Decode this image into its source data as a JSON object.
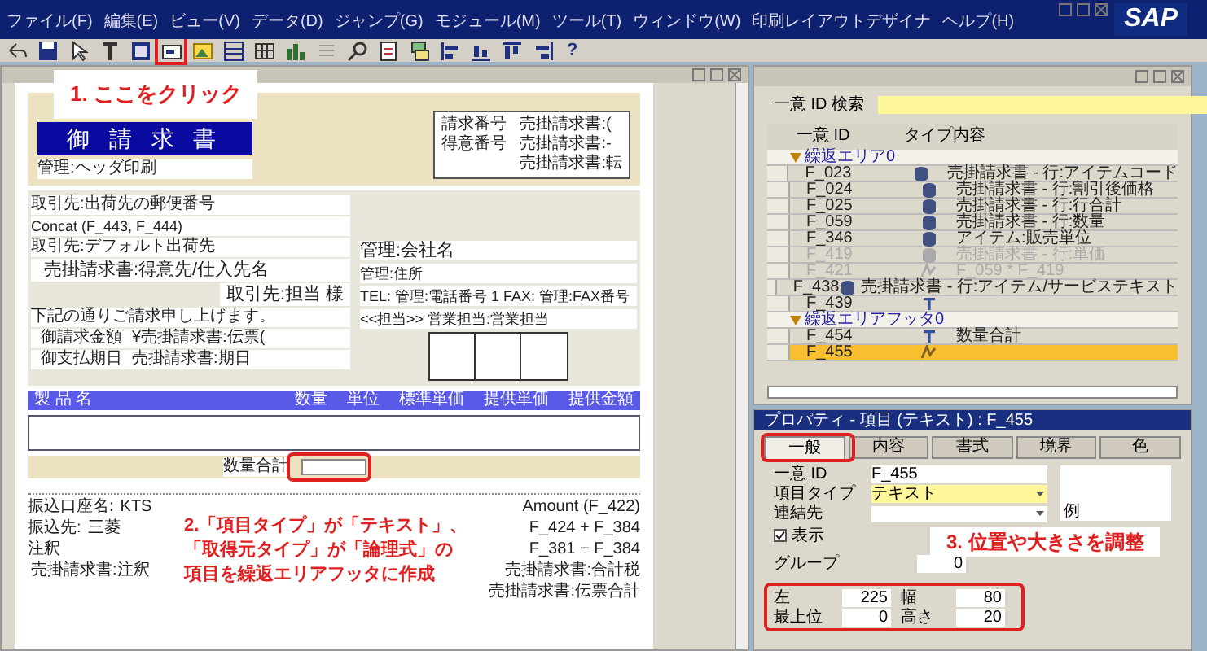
{
  "menu": [
    "ファイル(F)",
    "編集(E)",
    "ビュー(V)",
    "データ(D)",
    "ジャンプ(G)",
    "モジュール(M)",
    "ツール(T)",
    "ウィンドウ(W)",
    "印刷レイアウトデザイナ",
    "ヘルプ(H)"
  ],
  "brand": "SAP",
  "toolbar": [
    {
      "kind": "undo",
      "highlighted": false
    },
    {
      "kind": "save",
      "highlighted": false
    },
    {
      "kind": "pointer",
      "highlighted": false
    },
    {
      "kind": "text",
      "highlighted": false
    },
    {
      "kind": "frame",
      "highlighted": false
    },
    {
      "kind": "field",
      "highlighted": true
    },
    {
      "kind": "picture",
      "highlighted": false
    },
    {
      "kind": "table",
      "highlighted": false
    },
    {
      "kind": "grid",
      "highlighted": false
    },
    {
      "kind": "bars",
      "highlighted": false
    },
    {
      "kind": "lines",
      "highlighted": false
    },
    {
      "kind": "zoom",
      "highlighted": false
    },
    {
      "kind": "page",
      "highlighted": false
    },
    {
      "kind": "layers",
      "highlighted": false
    },
    {
      "kind": "align-left",
      "highlighted": false
    },
    {
      "kind": "align-bottom",
      "highlighted": false
    },
    {
      "kind": "align-top",
      "highlighted": false
    },
    {
      "kind": "align-right",
      "highlighted": false
    }
  ],
  "help_button": "?",
  "form": {
    "title": "御 請 求 書",
    "header_note": "管理:ヘッダ印刷",
    "info_box": [
      {
        "label": "請求番号",
        "value": "売掛請求書:("
      },
      {
        "label": "得意番号",
        "value": "売掛請求書:-"
      },
      {
        "value": "売掛請求書:転"
      }
    ],
    "address_left": [
      "取引先:出荷先の郵便番号",
      "Concat (F_443, F_444)",
      "取引先:デフォルト出荷先",
      "売掛請求書:得意先/仕入先名",
      "取引先:担当 様",
      "下記の通りご請求申し上げます。"
    ],
    "amount": {
      "label": "御請求金額",
      "value": "¥売掛請求書:伝票("
    },
    "due": {
      "label": "御支払期日",
      "value": "売掛請求書:期日"
    },
    "company": [
      "管理:会社名",
      "管理:住所",
      "TEL: 管理:電話番号 1 FAX: 管理:FAX番号",
      "<<担当>> 営業担当:営業担当"
    ],
    "columns": [
      "製 品 名",
      "数量",
      "単位",
      "標準単価",
      "提供単価",
      "提供金額"
    ],
    "footer_label": "数量合計",
    "bank": [
      {
        "label": "振込口座名:",
        "value": "KTS"
      },
      {
        "label": "振込先:",
        "value": "三菱"
      }
    ],
    "note_label": "注釈",
    "note_value": "売掛請求書:注釈",
    "totals": [
      "Amount (F_422)",
      "F_424 + F_384",
      "F_381 − F_384",
      "売掛請求書:合計税",
      "売掛請求書:伝票合計"
    ]
  },
  "callouts": [
    {
      "lines": [
        "1. ここをクリック"
      ]
    },
    {
      "lines": [
        "2.「項目タイプ」が「テキスト」、",
        "「取得元タイプ」が「論理式」の",
        "項目を繰返エリアフッタに作成"
      ]
    },
    {
      "lines": [
        "3. 位置や大きさを調整"
      ]
    }
  ],
  "item_list": {
    "search_label": "一意 ID 検索",
    "columns": [
      "一意 ID",
      "タイプ",
      "内容"
    ],
    "groups": [
      {
        "name": "繰返エリア0",
        "expanded": true,
        "rows": [
          {
            "id": "F_023",
            "kind": "field",
            "content": "売掛請求書 - 行:アイテムコード",
            "disabled": false,
            "selected": false
          },
          {
            "id": "F_024",
            "kind": "field",
            "content": "売掛請求書 - 行:割引後価格",
            "disabled": false,
            "selected": false
          },
          {
            "id": "F_025",
            "kind": "field",
            "content": "売掛請求書 - 行:行合計",
            "disabled": false,
            "selected": false
          },
          {
            "id": "F_059",
            "kind": "field",
            "content": "売掛請求書 - 行:数量",
            "disabled": false,
            "selected": false
          },
          {
            "id": "F_346",
            "kind": "field",
            "content": "アイテム:販売単位",
            "disabled": false,
            "selected": false
          },
          {
            "id": "F_419",
            "kind": "field",
            "content": "売掛請求書 - 行:単価",
            "disabled": true,
            "selected": false
          },
          {
            "id": "F_421",
            "kind": "formula",
            "content": "F_059 * F_419",
            "disabled": true,
            "selected": false
          },
          {
            "id": "F_438",
            "kind": "field",
            "content": "売掛請求書 - 行:アイテム/サービステキスト",
            "disabled": false,
            "selected": false
          },
          {
            "id": "F_439",
            "kind": "text",
            "disabled": false,
            "selected": false
          }
        ]
      },
      {
        "name": "繰返エリアフッタ0",
        "expanded": true,
        "rows": [
          {
            "id": "F_454",
            "kind": "text",
            "content": "数量合計",
            "disabled": false,
            "selected": false
          },
          {
            "id": "F_455",
            "kind": "formula",
            "disabled": false,
            "selected": true
          }
        ]
      }
    ]
  },
  "properties": {
    "title": "プロパティ - 項目 (テキスト) : F_455",
    "tabs": [
      {
        "label": "一般",
        "selected": true
      },
      {
        "label": "内容",
        "selected": false
      },
      {
        "label": "書式",
        "selected": false
      },
      {
        "label": "境界",
        "selected": false
      },
      {
        "label": "色",
        "selected": false
      }
    ],
    "id_label": "一意 ID",
    "id_value": "F_455",
    "type_label": "項目タイプ",
    "type_value": "テキスト",
    "link_label": "連結先",
    "preview_label": "例",
    "visible": {
      "label": "表示",
      "checked": true
    },
    "group_label": "グループ",
    "group_value": "0",
    "position": [
      {
        "label": "左",
        "value": "225"
      },
      {
        "label": "幅",
        "value": "80"
      },
      {
        "label": "最上位",
        "value": "0"
      },
      {
        "label": "高さ",
        "value": "20"
      }
    ]
  }
}
